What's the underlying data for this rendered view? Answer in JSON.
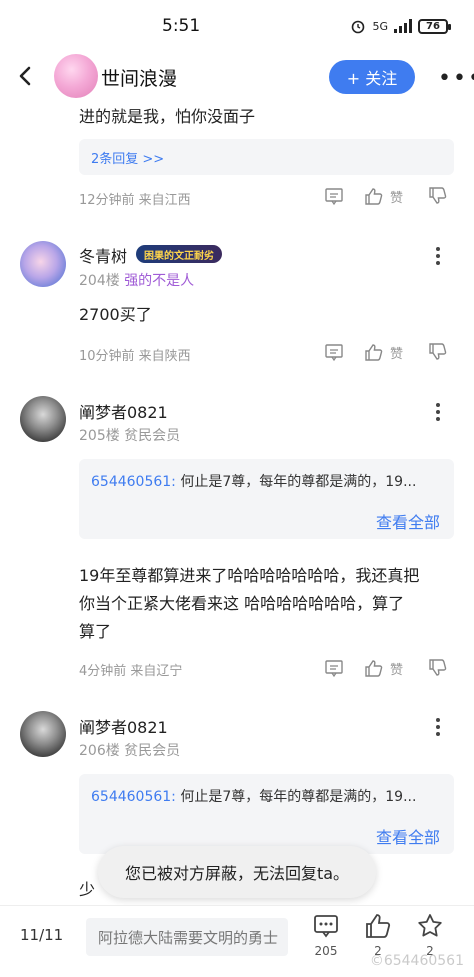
{
  "status": {
    "time": "5:51",
    "network": "5G",
    "battery": "76"
  },
  "header": {
    "name": "世间浪漫",
    "follow_label": "+ 关注"
  },
  "comments": [
    {
      "text": "进的就是我，怕你没面子",
      "replies_link": "2条回复 >>",
      "meta": "12分钟前 来自江西",
      "like_label": "赞"
    },
    {
      "name": "冬青树",
      "badge": "困果的文正耐劣",
      "floor": "204楼",
      "title": "强的不是人",
      "text": "2700买了",
      "meta": "10分钟前 来自陕西",
      "like_label": "赞"
    },
    {
      "name": "阐梦者0821",
      "floor_sub": "205楼 贫民会员",
      "quote_user": "654460561:",
      "quote_text": "何止是7尊，每年的尊都是满的，19...",
      "see_all": "查看全部",
      "text_lines": [
        "19年至尊都算进来了哈哈哈哈哈哈哈，我还真把",
        "你当个正紧大佬看来这 哈哈哈哈哈哈哈，算了",
        "算了"
      ],
      "meta": "4分钟前 来自辽宁",
      "like_label": "赞"
    },
    {
      "name": "阐梦者0821",
      "floor_sub": "206楼 贫民会员",
      "quote_user": "654460561:",
      "quote_text": "何止是7尊，每年的尊都是满的，19...",
      "see_all": "查看全部",
      "text_partial": "少"
    }
  ],
  "toast": "您已被对方屏蔽，无法回复ta。",
  "bottom": {
    "page": "11/11",
    "reply_placeholder": "阿拉德大陆需要文明的勇士",
    "comment_count": "205",
    "like_count": "2",
    "fav_count": "2"
  },
  "watermark": "©654460561"
}
